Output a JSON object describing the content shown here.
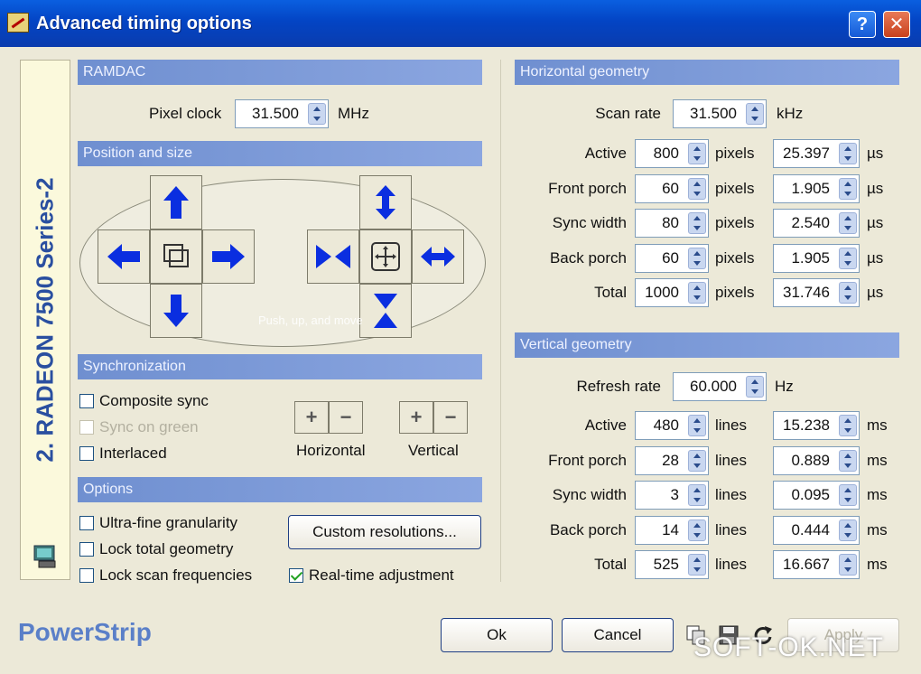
{
  "window": {
    "title": "Advanced timing options",
    "help_label": "?",
    "close_label": "✕"
  },
  "sidebar": {
    "device": "2. RADEON 7500 Series-2"
  },
  "ramdac": {
    "heading": "RAMDAC",
    "pixel_clock_label": "Pixel clock",
    "pixel_clock_value": "31.500",
    "pixel_clock_unit": "MHz"
  },
  "position": {
    "heading": "Position and size",
    "caption": "Push, up, and move"
  },
  "sync": {
    "heading": "Synchronization",
    "composite": "Composite sync",
    "sync_on_green": "Sync on green",
    "interlaced": "Interlaced",
    "horizontal_label": "Horizontal",
    "vertical_label": "Vertical",
    "plus": "+",
    "minus": "−"
  },
  "options": {
    "heading": "Options",
    "ultra_fine": "Ultra-fine granularity",
    "lock_total": "Lock total geometry",
    "lock_scan": "Lock scan frequencies",
    "custom_res": "Custom resolutions...",
    "realtime": "Real-time adjustment"
  },
  "hgeo": {
    "heading": "Horizontal geometry",
    "rate_label": "Scan rate",
    "rate_value": "31.500",
    "rate_unit": "kHz",
    "unit_a": "pixels",
    "unit_b": "µs",
    "rows": [
      {
        "label": "Active",
        "a": "800",
        "b": "25.397"
      },
      {
        "label": "Front porch",
        "a": "60",
        "b": "1.905"
      },
      {
        "label": "Sync width",
        "a": "80",
        "b": "2.540"
      },
      {
        "label": "Back porch",
        "a": "60",
        "b": "1.905"
      },
      {
        "label": "Total",
        "a": "1000",
        "b": "31.746"
      }
    ]
  },
  "vgeo": {
    "heading": "Vertical geometry",
    "rate_label": "Refresh rate",
    "rate_value": "60.000",
    "rate_unit": "Hz",
    "unit_a": "lines",
    "unit_b": "ms",
    "rows": [
      {
        "label": "Active",
        "a": "480",
        "b": "15.238"
      },
      {
        "label": "Front porch",
        "a": "28",
        "b": "0.889"
      },
      {
        "label": "Sync width",
        "a": "3",
        "b": "0.095"
      },
      {
        "label": "Back porch",
        "a": "14",
        "b": "0.444"
      },
      {
        "label": "Total",
        "a": "525",
        "b": "16.667"
      }
    ]
  },
  "footer": {
    "brand": "PowerStrip",
    "ok": "Ok",
    "cancel": "Cancel",
    "apply": "Apply"
  },
  "watermark": "SOFT-OK.NET",
  "colors": {
    "section_bar": "#7d9ad8",
    "arrow_blue": "#0a2ee0",
    "titlebar": "#0a4fd0"
  }
}
